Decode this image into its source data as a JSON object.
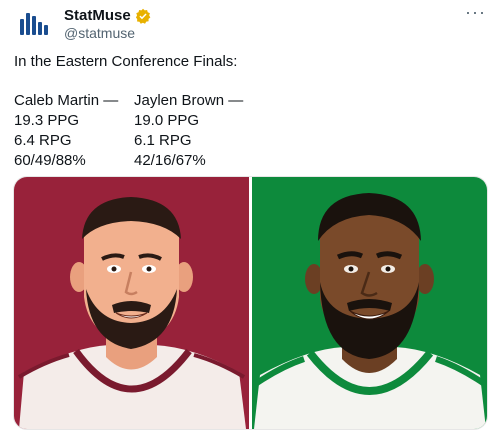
{
  "author": {
    "display_name": "StatMuse",
    "handle": "@statmuse",
    "verified": true,
    "avatar_icon": "statmuse-logo-icon",
    "brand_color": "#1a4d8f",
    "verified_color": "#e8b100"
  },
  "menu_icon": "more-horizontal-icon",
  "tweet": {
    "intro": "In the Eastern Conference Finals:",
    "players": [
      {
        "name": "Caleb Martin —",
        "ppg": "19.3 PPG",
        "rpg": "6.4 RPG",
        "shooting": "60/49/88%"
      },
      {
        "name": "Jaylen Brown —",
        "ppg": "19.0 PPG",
        "rpg": "6.1 RPG",
        "shooting": "42/16/67%"
      }
    ]
  },
  "media": {
    "left_panel": {
      "background": "#98223a",
      "jersey_trim": "#98223a"
    },
    "right_panel": {
      "background": "#0d8a3c",
      "jersey_trim": "#0d8a3c"
    }
  }
}
